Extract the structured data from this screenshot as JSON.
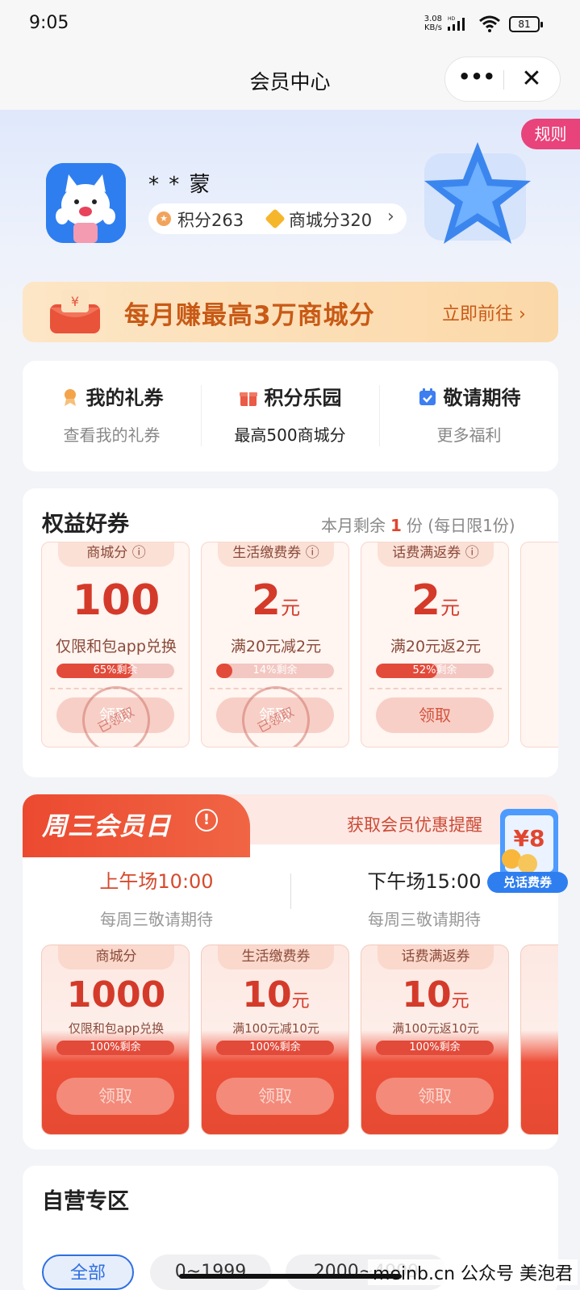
{
  "status": {
    "time": "9:05",
    "net_speed_top": "3.08",
    "net_speed_bottom": "KB/s",
    "hd": "HD",
    "battery": "81"
  },
  "nav": {
    "title": "会员中心",
    "more": "•••",
    "close": "✕"
  },
  "header": {
    "rule": "规则",
    "username": "* * 蒙",
    "points": "积分263",
    "mall_points": "商城分320",
    "arrow": "›"
  },
  "promo": {
    "text": "每月赚最高3万商城分",
    "go": "立即前往 ›"
  },
  "quick": [
    {
      "title": "我的礼券",
      "sub": "查看我的礼券"
    },
    {
      "title": "积分乐园",
      "sub": "最高500商城分"
    },
    {
      "title": "敬请期待",
      "sub": "更多福利"
    }
  ],
  "coupons": {
    "title": "权益好券",
    "remain_prefix": "本月剩余",
    "remain_count": "1",
    "remain_suffix": "份 (每日限1份)",
    "items": [
      {
        "tab": "商城分 ⓘ",
        "amount": "100",
        "unit": "",
        "desc": "仅限和包app兑换",
        "progress_label": "65%剩余",
        "progress": 0.65,
        "button": "领取",
        "stamp": "已领取"
      },
      {
        "tab": "生活缴费券 ⓘ",
        "amount": "2",
        "unit": "元",
        "desc": "满20元减2元",
        "progress_label": "14%剩余",
        "progress": 0.14,
        "button": "领取",
        "stamp": "已领取"
      },
      {
        "tab": "话费满返券 ⓘ",
        "amount": "2",
        "unit": "元",
        "desc": "满20元返2元",
        "progress_label": "52%剩余",
        "progress": 0.52,
        "button": "领取"
      }
    ]
  },
  "wednesday": {
    "title": "周三会员日",
    "info_icon": "!",
    "remind": "获取会员优惠提醒",
    "float_amount": "¥8",
    "float_label": "兑话费券",
    "sessions": [
      {
        "time": "上午场10:00",
        "sub": "每周三敬请期待"
      },
      {
        "time": "下午场15:00",
        "sub": "每周三敬请期待"
      }
    ],
    "items": [
      {
        "tab": "商城分",
        "amount": "1000",
        "unit": "",
        "desc": "仅限和包app兑换",
        "progress_label": "100%剩余",
        "button": "领取"
      },
      {
        "tab": "生活缴费券",
        "amount": "10",
        "unit": "元",
        "desc": "满100元减10元",
        "progress_label": "100%剩余",
        "button": "领取"
      },
      {
        "tab": "话费满返券",
        "amount": "10",
        "unit": "元",
        "desc": "满100元返10元",
        "progress_label": "100%剩余",
        "button": "领取"
      }
    ]
  },
  "zone": {
    "title": "自营专区",
    "chips": [
      "全部",
      "0~1999",
      "2000~4999"
    ]
  },
  "watermark": "meinb.cn 公众号 美泡君",
  "colors": {
    "accent_red": "#e24a3a",
    "promo_orange": "#c85a16",
    "rule_pink": "#e8437a",
    "brand_blue": "#2e7ef0"
  }
}
